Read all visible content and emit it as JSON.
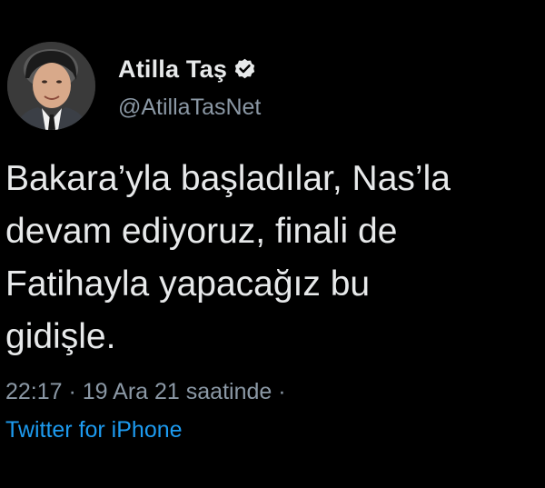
{
  "author": {
    "display_name": "Atilla Taş",
    "handle": "@AtillaTasNet",
    "verified_icon": "verified-badge-icon"
  },
  "tweet": {
    "text": "Bakara’yla başladılar, Nas’la\ndevam ediyoruz, finali de\nFatihayla yapacağız bu\ngidişle.",
    "timestamp": "22:17 · 19 Ara 21 saatinde ·",
    "source": "Twitter for iPhone"
  },
  "colors": {
    "background": "#000000",
    "text": "#e7e9ea",
    "secondary": "#8b98a5",
    "link": "#1d9bf0"
  }
}
